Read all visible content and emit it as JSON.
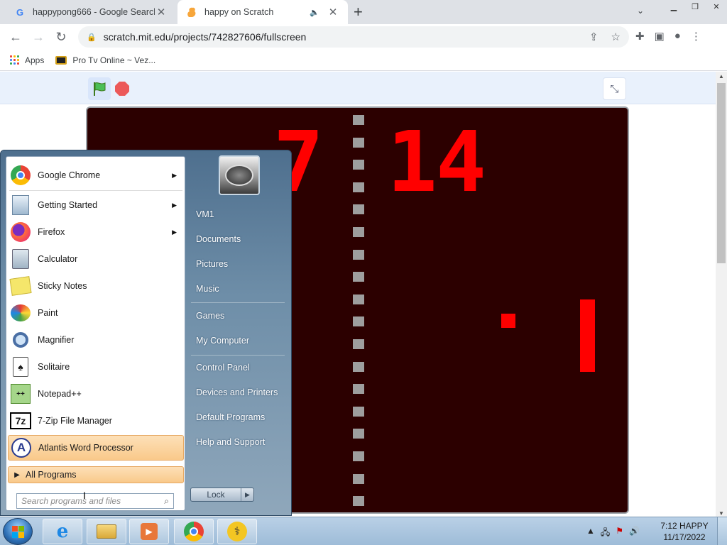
{
  "browser": {
    "tabs": [
      {
        "title": "happypong666 - Google Search",
        "favicon": "google-icon"
      },
      {
        "title": "happy on Scratch",
        "favicon": "scratch-icon",
        "audio": "speaker-icon"
      }
    ],
    "url": "scratch.mit.edu/projects/742827606/fullscreen",
    "bookmarks": [
      {
        "label": "Apps",
        "icon": "apps-grid-icon"
      },
      {
        "label": "Pro Tv Online ~ Vez...",
        "icon": "tv-icon"
      }
    ]
  },
  "game": {
    "score_left": "7",
    "score_right": "14"
  },
  "start_menu": {
    "programs": [
      {
        "label": "Google Chrome",
        "icon": "chrome-icon",
        "submenu": true
      },
      {
        "label": "Getting Started",
        "icon": "getting-started-icon",
        "submenu": true
      },
      {
        "label": "Firefox",
        "icon": "firefox-icon",
        "submenu": true
      },
      {
        "label": "Calculator",
        "icon": "calculator-icon",
        "submenu": false
      },
      {
        "label": "Sticky Notes",
        "icon": "sticky-notes-icon",
        "submenu": false
      },
      {
        "label": "Paint",
        "icon": "paint-icon",
        "submenu": false
      },
      {
        "label": "Magnifier",
        "icon": "magnifier-icon",
        "submenu": false
      },
      {
        "label": "Solitaire",
        "icon": "solitaire-icon",
        "submenu": false
      },
      {
        "label": "Notepad++",
        "icon": "notepad-plus-plus-icon",
        "submenu": false
      },
      {
        "label": "7-Zip File Manager",
        "icon": "7zip-icon",
        "submenu": false
      },
      {
        "label": "Atlantis Word Processor",
        "icon": "atlantis-icon",
        "submenu": false,
        "highlighted": true
      }
    ],
    "all_programs": "All Programs",
    "search_placeholder": "Search programs and files",
    "right_links": [
      "VM1",
      "Documents",
      "Pictures",
      "Music",
      "Games",
      "My Computer",
      "Control Panel",
      "Devices and Printers",
      "Default Programs",
      "Help and Support"
    ],
    "lock_label": "Lock"
  },
  "taskbar": {
    "apps": [
      "internet-explorer-icon",
      "file-explorer-icon",
      "media-player-icon",
      "chrome-icon",
      "troubleshooter-icon"
    ],
    "clock_time": "7:12 HAPPY",
    "clock_date": "11/17/2022"
  },
  "colors": {
    "stage_bg": "#2c0000",
    "score_red": "#ff0000",
    "net_gray": "#9e9e9e"
  }
}
